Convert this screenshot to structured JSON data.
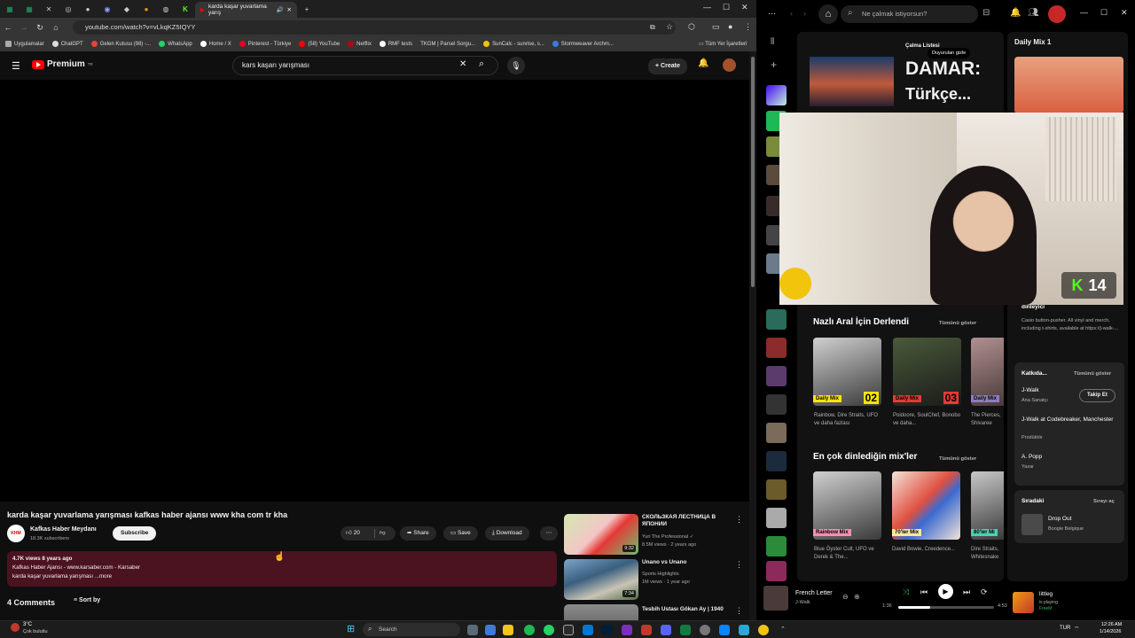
{
  "browser": {
    "active_tab_title": "karda kaşar yuvarlama yarış",
    "url": "youtube.com/watch?v=vLkqKZ5IQYY",
    "bookmarks": [
      "Uygulamalar",
      "ChatGPT",
      "Gelen Kutusu (98) -...",
      "WhatsApp",
      "Home / X",
      "Pinterest - Türkiye",
      "(58) YouTube",
      "Netflix",
      "RMF tests",
      "TKGM | Parsel Sorgu...",
      "SunCalc - sunrise, s...",
      "Stormweaver Archm..."
    ],
    "all_bookmarks": "Tüm Yer İşaretleri"
  },
  "youtube": {
    "logo": "Premium",
    "logo_region": "TR",
    "search_query": "kars kaşarı yarışması",
    "create_label": "Create",
    "video_title": "karda kaşar yuvarlama yarışması kafkas haber ajansı www kha com tr kha",
    "channel_name": "Kafkas Haber Meydanı",
    "subscribers": "18.3K subscribers",
    "channel_avatar_text": "KHM",
    "subscribe_label": "Subscribe",
    "likes": "20",
    "share_label": "Share",
    "save_label": "Save",
    "download_label": "Download",
    "desc_stats": "4.7K views  8 years ago",
    "desc_line1": "Kafkas Haber Ajansı - www.karsaber.com - Karsaber",
    "desc_line2": "karda kaşar yuvarlama yarışması ...more",
    "comments_label": "4 Comments",
    "sort_label": "Sort by",
    "recommendations": [
      {
        "title": "СКОЛЬЗКАЯ ЛЕСТНИЦА В ЯПОНИИ",
        "channel": "Yuri The Professional ✓",
        "meta": "8.5M views · 2 years ago",
        "duration": "9:32"
      },
      {
        "title": "Unano vs Unano",
        "channel": "Sports Highlights",
        "meta": "1M views · 1 year ago",
        "duration": "7:34"
      },
      {
        "title": "Tesbih Ustası Gökan Ay | 1940",
        "channel": "",
        "meta": "",
        "duration": ""
      }
    ]
  },
  "spotify": {
    "search_placeholder": "Ne çalmak istiyorsun?",
    "hero_label": "Çalma Listesi",
    "hero_title_1": "DAMAR:",
    "hero_title_2": "Türkçe...",
    "hide_ads": "Duyuruları gizle",
    "section1_title": "Nazlı Aral İçin Derlendi",
    "section2_title": "En çok dinlediğin mix'ler",
    "show_all": "Tümünü göster",
    "daily_mixes": [
      {
        "badge": "Daily Mix",
        "num": "02",
        "caption": "Rainbow, Dire Straits, UFO ve daha fazlası"
      },
      {
        "badge": "Daily Mix",
        "num": "03",
        "caption": "Poidoore, SoulChef, Bonobo ve daha..."
      },
      {
        "badge": "Daily Mix",
        "num": "",
        "caption": "The Pierces, Shivaree"
      }
    ],
    "top_mixes": [
      {
        "badge": "Rainbow Mix",
        "caption": "Blue Öyster Cult, UFO ve Derek & The..."
      },
      {
        "badge": "70'ler Mix",
        "caption": "David Bowie, Creedence..."
      },
      {
        "badge": "80'ler Mi",
        "caption": "Dire Straits, Whitesnake"
      }
    ],
    "right_panel": {
      "title": "Daily Mix 1",
      "artist_desc_head": "dinleyici",
      "artist_desc": "Casio button-pusher. All vinyl and merch, including t-shirts, available at https://j-walk-...",
      "credits_title": "Katkıda...",
      "credits_show_all": "Tümünü göster",
      "credits": [
        {
          "name": "J-Walk",
          "role": "Ana Sanatçı"
        },
        {
          "name": "J-Walk at Codebreaker, Manchester",
          "role": "Prodüktör"
        },
        {
          "name": "A. Popp",
          "role": "Yazar"
        }
      ],
      "follow_label": "Takip Et",
      "queue_title": "Sıradaki",
      "queue_open": "Sırayı aç",
      "queue_track": "Drop Out",
      "queue_artist": "Boogie Belgique"
    },
    "now_playing_title": "French Letter",
    "now_playing_artist": "J-Walk",
    "elapsed": "1:36",
    "duration": "4:53",
    "progress": 0.33,
    "friend_name": "littleg",
    "friend_status": "is playing",
    "friend_app": "FreeM",
    "overlay_count": "14"
  },
  "taskbar": {
    "weather_temp": "3°C",
    "weather_desc": "Çok bulutlu",
    "search_label": "Search",
    "language": "TUR",
    "time": "12:26 AM",
    "date": "1/14/2026"
  }
}
